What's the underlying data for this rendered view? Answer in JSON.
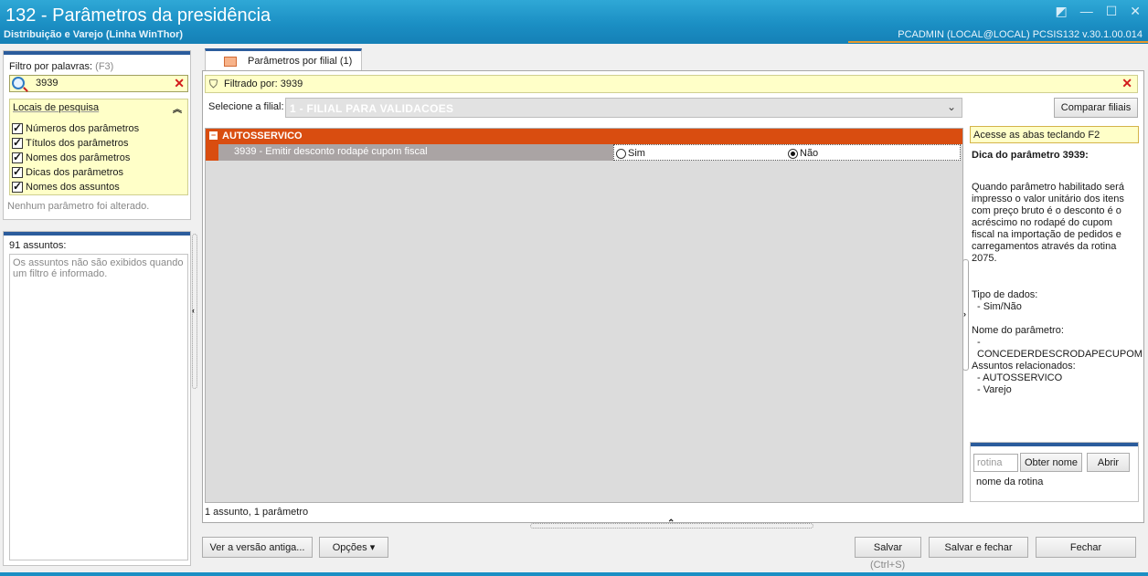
{
  "window": {
    "title": "132 - Parâmetros da presidência",
    "subtitle": "Distribuição e Varejo (Linha WinThor)",
    "user_info": "PCADMIN (LOCAL@LOCAL)   PCSIS132  v.30.1.00.014",
    "buttons": [
      "◩",
      "—",
      "☐",
      "✕"
    ]
  },
  "filter": {
    "label": "Filtro por palavras:",
    "shortcut": "(F3)",
    "search_value": "3939",
    "locations_title": "Locais de pesquisa",
    "locations": [
      {
        "label": "Números dos parâmetros",
        "checked": true
      },
      {
        "label": "Títulos dos parâmetros",
        "checked": true
      },
      {
        "label": "Nomes dos parâmetros",
        "checked": true
      },
      {
        "label": "Dicas dos parâmetros",
        "checked": true
      },
      {
        "label": "Nomes dos assuntos",
        "checked": true
      }
    ],
    "status": "Nenhum parâmetro foi alterado."
  },
  "subjects": {
    "count_label": "91 assuntos:",
    "empty_message": "Os assuntos não são exibidos quando um filtro é informado."
  },
  "tab": {
    "label": "Parâmetros por filial",
    "count": "(1)"
  },
  "filtered_bar": {
    "text": "Filtrado por: 3939"
  },
  "branch": {
    "label": "Selecione a filial:",
    "value": "1 - FILIAL PARA VALIDACOES",
    "compare_button": "Comparar filiais"
  },
  "grid": {
    "group_name": "AUTOSSERVICO",
    "group_toggle": "−",
    "params": [
      {
        "name": "3939 - Emitir desconto rodapé cupom fiscal",
        "options": [
          "Sim",
          "Não"
        ],
        "selected": "Não"
      }
    ],
    "footer": "1 assunto, 1 parâmetro"
  },
  "tip_panel": {
    "hint": "Acesse as abas teclando F2",
    "title": "Dica do parâmetro 3939:",
    "body": "Quando parâmetro habilitado será impresso o valor unitário dos itens com preço bruto é o desconto é o acréscimo no rodapé do cupom fiscal na importação de pedidos e carregamentos através da rotina 2075.",
    "data_type_label": "Tipo de dados:",
    "data_type_value": "- Sim/Não",
    "param_name_label": "Nome do parâmetro:",
    "param_name_value": "- CONCEDERDESCRODAPECUPOM",
    "related_label": "Assuntos relacionados:",
    "related": [
      "- AUTOSSERVICO",
      "- Varejo"
    ]
  },
  "routine": {
    "placeholder": "rotina",
    "get_name_button": "Obter nome",
    "open_button": "Abrir",
    "caption": "nome da rotina"
  },
  "footer": {
    "old_version_button": "Ver a versão antiga...",
    "options_button": "Opções ▾",
    "save_button": "Salvar",
    "save_shortcut": "(Ctrl+S)",
    "save_close_button": "Salvar e fechar",
    "close_button": "Fechar"
  },
  "colors": {
    "title_bar": "#1b8fc4",
    "accent_orange": "#d94d10",
    "highlight_yellow": "#ffffc8",
    "panel_bar": "#2b5c9c"
  }
}
